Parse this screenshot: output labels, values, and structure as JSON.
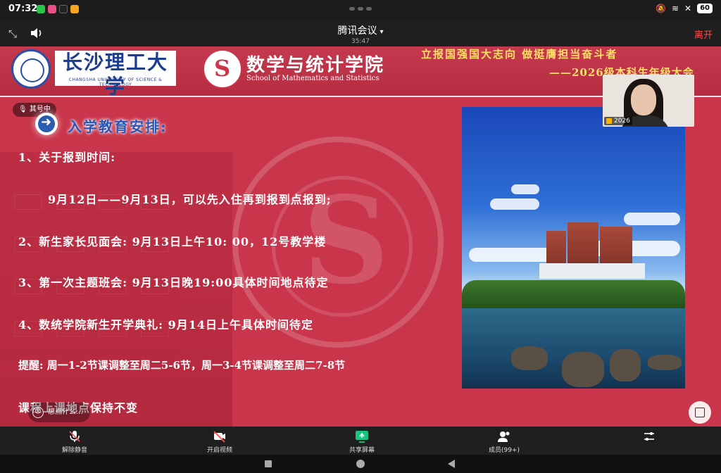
{
  "status_bar": {
    "time": "07:32",
    "battery": "60"
  },
  "meeting": {
    "app_title": "腾讯会议",
    "elapsed": "35:47",
    "leave_label": "离开",
    "speaking_label": "其号中"
  },
  "slide": {
    "university_name": "长沙理工大学",
    "university_name_en": "CHANGSHA UNIVERSITY OF SCIENCE & TECHNOLOGY",
    "school_name": "数学与统计学院",
    "school_name_en": "School of Mathematics and Statistics",
    "slogan_line1": "立报国强国大志向 做挺膺担当奋斗者",
    "slogan_line2": "——2026级本科生年级大会",
    "section_title": "入学教育安排:",
    "lines": [
      "1、关于报到时间:",
      "9月12日——9月13日，可以先入住再到报到点报到;",
      "2、新生家长见面会: 9月13日上午10: 00，12号教学楼",
      "3、第一次主题班会: 9月13日晚19:00具体时间地点待定",
      "4、数统学院新生开学典礼: 9月14日上午具体时间待定",
      "提醒: 周一1-2节课调整至周二5-6节，周一3-4节课调整至周二7-8节",
      "课程上课地点保持不变"
    ]
  },
  "self_video": {
    "label": "2026"
  },
  "hint": {
    "text": "想点什么..."
  },
  "toolbar": {
    "unmute": "解除静音",
    "video": "开启视频",
    "share": "共享屏幕",
    "members": "成员(99+)"
  },
  "colors": {
    "slide_red": "#c9354a",
    "title_blue": "#2955b5",
    "slogan_yellow": "#ffe066",
    "leave_red": "#ff4c4c",
    "share_green": "#19c37d"
  }
}
